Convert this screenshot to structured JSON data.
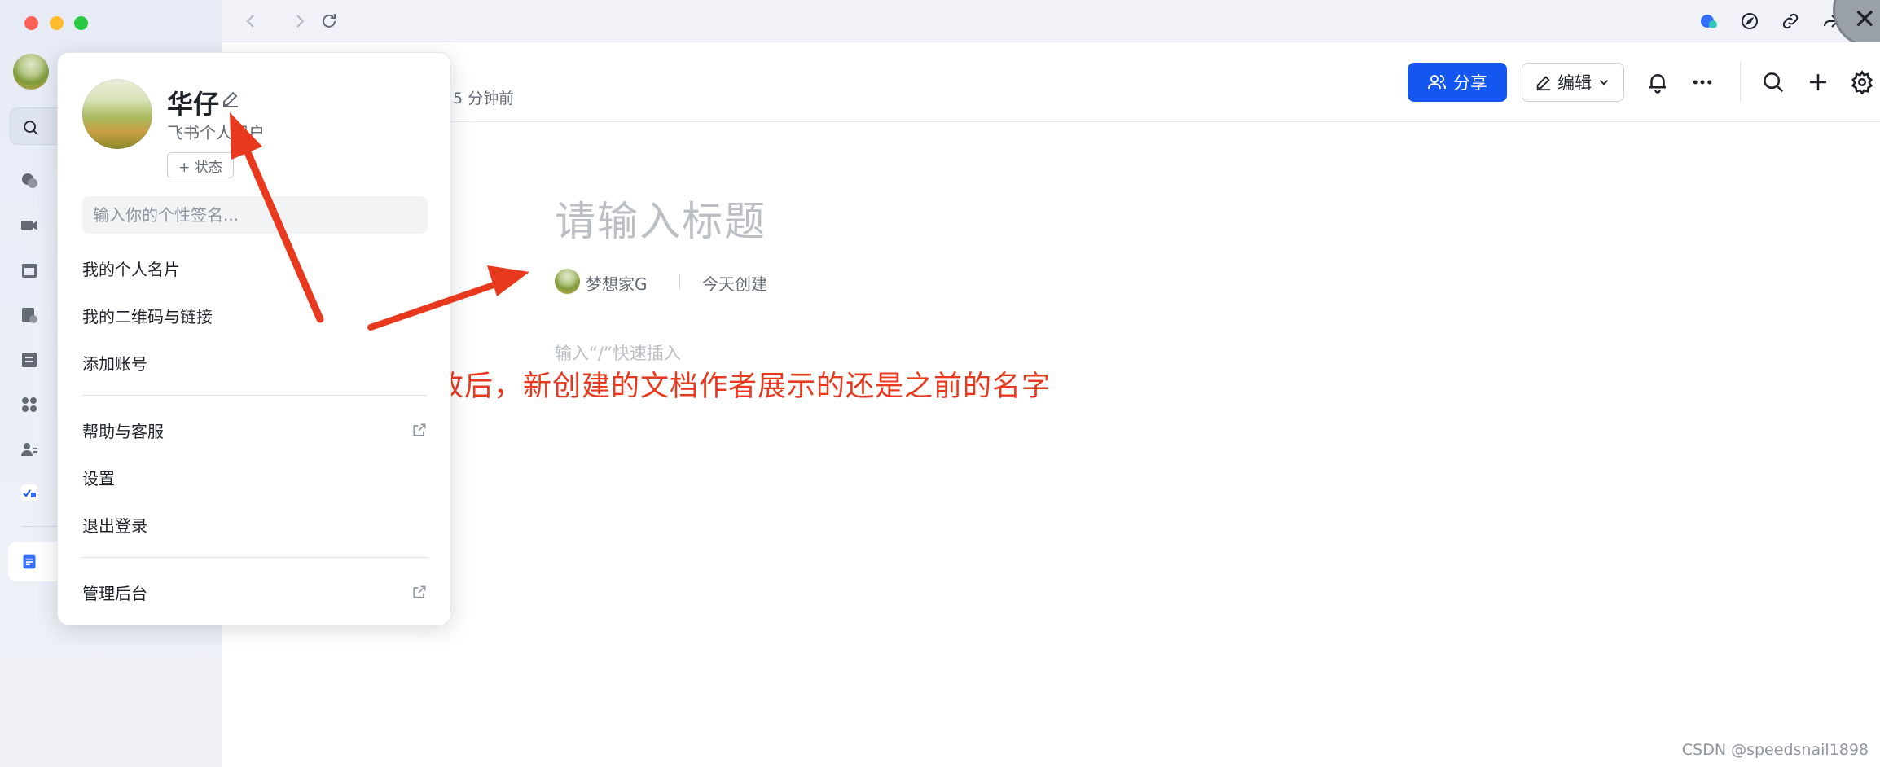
{
  "doc": {
    "edit_time": "5 分钟前",
    "title_placeholder": "请输入标题",
    "author_name": "梦想家G",
    "created": "今天创建",
    "insert_hint": "输入“/”快速插入"
  },
  "header": {
    "share_label": "分享",
    "edit_label": "编辑"
  },
  "profile": {
    "name": "华仔",
    "account_type": "飞书个人用户",
    "status_label": "+ 状态",
    "signature_placeholder": "输入你的个性签名...",
    "menu": {
      "business_card": "我的个人名片",
      "qr_link": "我的二维码与链接",
      "add_account": "添加账号",
      "help": "帮助与客服",
      "settings": "设置",
      "logout": "退出登录",
      "admin": "管理后台"
    }
  },
  "annotation": "飞书作者姓名修改后，新创建的文档作者展示的还是之前的名字",
  "watermark": "CSDN @speedsnail1898",
  "colors": {
    "accent": "#1456f0",
    "annotation": "#e8391f",
    "traffic_red": "#ff5f57",
    "traffic_yellow": "#febc2e",
    "traffic_green": "#28c840"
  }
}
